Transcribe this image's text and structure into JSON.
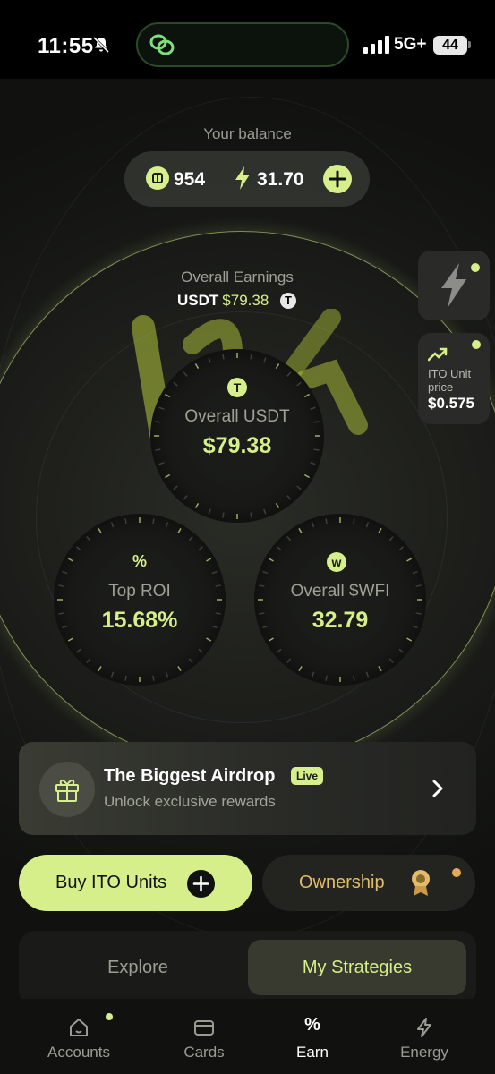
{
  "status_bar": {
    "time": "11:55",
    "network": "5G+",
    "battery": "44"
  },
  "balance": {
    "label": "Your balance",
    "coins": "954",
    "energy": "31.70"
  },
  "earnings": {
    "label": "Overall Earnings",
    "currency": "USDT",
    "amount": "$79.38"
  },
  "dials": {
    "usdt": {
      "icon": "T",
      "label": "Overall USDT",
      "value": "$79.38"
    },
    "roi": {
      "icon": "%",
      "label": "Top ROI",
      "value": "15.68%"
    },
    "wfi": {
      "icon": "w",
      "label": "Overall $WFI",
      "value": "32.79"
    }
  },
  "side": {
    "ito_label": "ITO Unit price",
    "ito_price": "$0.575"
  },
  "airdrop": {
    "title": "The Biggest Airdrop",
    "badge": "Live",
    "subtitle": "Unlock exclusive rewards"
  },
  "actions": {
    "buy": "Buy ITO Units",
    "ownership": "Ownership"
  },
  "tabs": {
    "explore": "Explore",
    "mine": "My Strategies"
  },
  "nav": [
    {
      "label": "Accounts",
      "icon": "house-icon"
    },
    {
      "label": "Cards",
      "icon": "card-icon"
    },
    {
      "label": "Earn",
      "icon": "percent-icon"
    },
    {
      "label": "Energy",
      "icon": "bolt-icon"
    }
  ],
  "colors": {
    "accent": "#d6ef8a",
    "gold": "#e3bb6a",
    "background": "#151614"
  }
}
